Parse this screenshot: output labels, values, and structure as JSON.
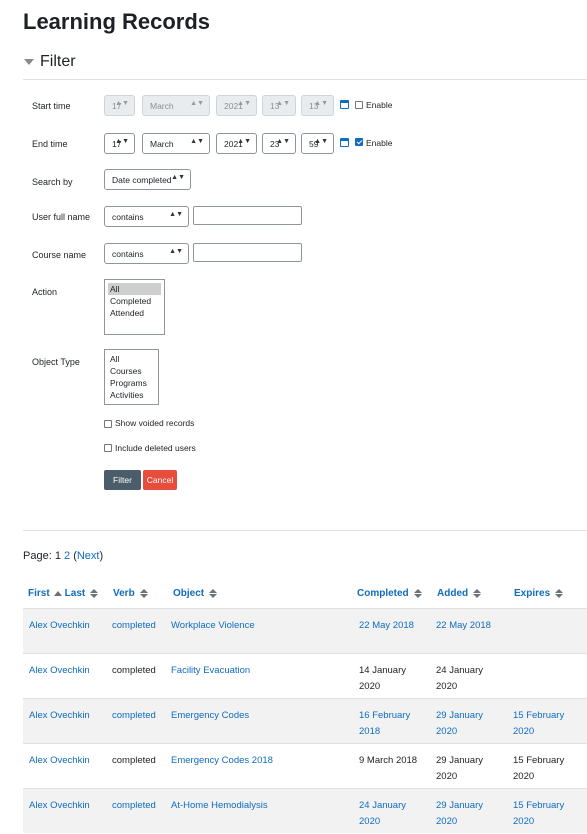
{
  "page": {
    "title": "Learning Records"
  },
  "filter": {
    "heading": "Filter",
    "start_time": {
      "label": "Start time",
      "day": "17",
      "month": "March",
      "year": "2021",
      "hour": "13",
      "minute": "13",
      "enable_label": "Enable",
      "enabled": false
    },
    "end_time": {
      "label": "End time",
      "day": "17",
      "month": "March",
      "year": "2021",
      "hour": "23",
      "minute": "59",
      "enable_label": "Enable",
      "enabled": true
    },
    "search_by": {
      "label": "Search by",
      "value": "Date completed"
    },
    "user_full_name": {
      "label": "User full name",
      "operator": "contains",
      "value": ""
    },
    "course_name": {
      "label": "Course name",
      "operator": "contains",
      "value": ""
    },
    "action": {
      "label": "Action",
      "options": [
        "All",
        "Completed",
        "Attended"
      ],
      "selected": "All"
    },
    "object_type": {
      "label": "Object Type",
      "options": [
        "All",
        "Courses",
        "Programs",
        "Activities"
      ]
    },
    "show_voided": "Show voided records",
    "include_deleted": "Include deleted users",
    "filter_button": "Filter",
    "cancel_button": "Cancel"
  },
  "pager": {
    "prefix": "Page:",
    "current": "1",
    "page2": "2",
    "next": "Next",
    "open_paren": "(",
    "close_paren": ")"
  },
  "table": {
    "headers": {
      "first": "First",
      "last": "Last",
      "verb": "Verb",
      "object": "Object",
      "completed": "Completed",
      "added": "Added",
      "expires": "Expires"
    },
    "rows": [
      {
        "user": "Alex Ovechkin",
        "verb": "completed",
        "verb_link": true,
        "object": "Workplace Violence",
        "completed": [
          "22 May 2018"
        ],
        "completed_link": true,
        "added": [
          "22 May 2018"
        ],
        "added_link": true,
        "expires": [
          ""
        ],
        "expires_link": false
      },
      {
        "user": "Alex Ovechkin",
        "verb": "completed",
        "verb_link": false,
        "object": "Facility Evacuation",
        "completed": [
          "14 January",
          "2020"
        ],
        "completed_link": false,
        "added": [
          "24 January",
          "2020"
        ],
        "added_link": false,
        "expires": [
          ""
        ],
        "expires_link": false
      },
      {
        "user": "Alex Ovechkin",
        "verb": "completed",
        "verb_link": true,
        "object": "Emergency Codes",
        "completed": [
          "16 February",
          "2018"
        ],
        "completed_link": true,
        "added": [
          "29 January",
          "2020"
        ],
        "added_link": true,
        "expires": [
          "15 February",
          "2020"
        ],
        "expires_link": true
      },
      {
        "user": "Alex Ovechkin",
        "verb": "completed",
        "verb_link": false,
        "object": "Emergency Codes 2018",
        "completed": [
          "9 March 2018"
        ],
        "completed_link": false,
        "added": [
          "29 January",
          "2020"
        ],
        "added_link": false,
        "expires": [
          "15 February",
          "2020"
        ],
        "expires_link": false
      },
      {
        "user": "Alex Ovechkin",
        "verb": "completed",
        "verb_link": true,
        "object": "At-Home Hemodialysis",
        "completed": [
          "24 January",
          "2020"
        ],
        "completed_link": true,
        "added": [
          "29 January",
          "2020"
        ],
        "added_link": true,
        "expires": [
          "15 February",
          "2020"
        ],
        "expires_link": true
      }
    ]
  }
}
